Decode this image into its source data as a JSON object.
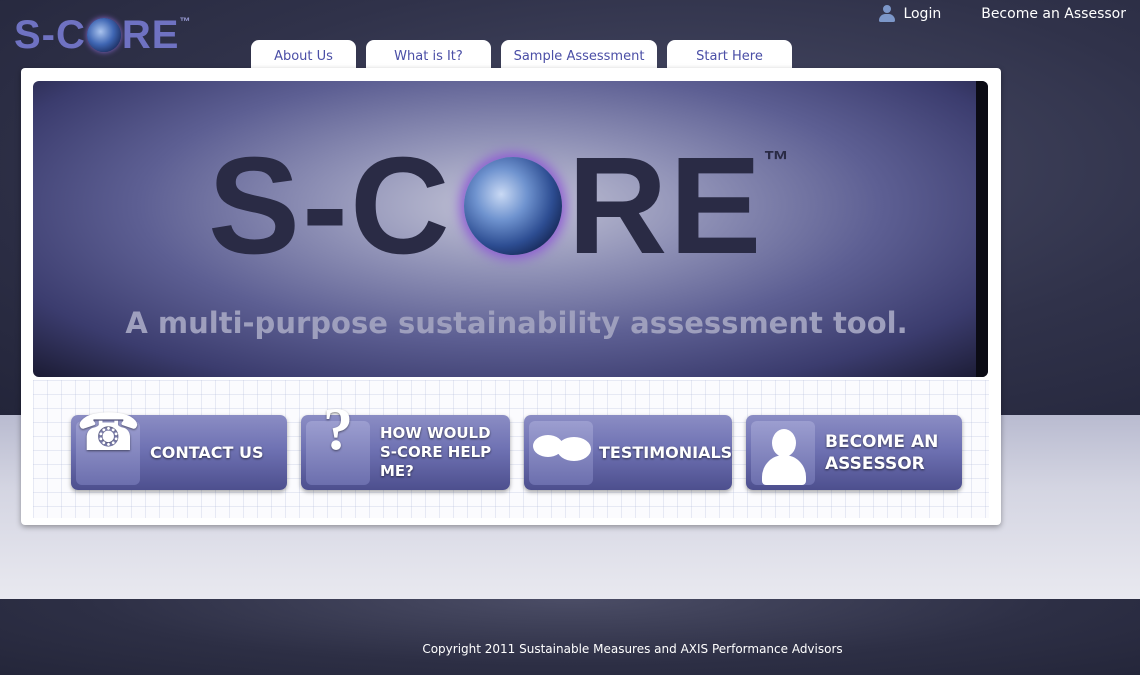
{
  "header": {
    "logo_left": "S-C",
    "logo_right": "RE",
    "logo_tm": "™",
    "top_links": {
      "login": "Login",
      "become_assessor": "Become an Assessor"
    }
  },
  "nav": {
    "tabs": [
      {
        "label": "About Us"
      },
      {
        "label": "What is It?"
      },
      {
        "label": "Sample Assessment"
      },
      {
        "label": "Start Here"
      }
    ]
  },
  "hero": {
    "logo_left": "S-C",
    "logo_right": "RE",
    "logo_tm": "™",
    "tagline": "A multi-purpose sustainability assessment tool."
  },
  "features": [
    {
      "label": "CONTACT US",
      "icon": "phone-icon"
    },
    {
      "label": "HOW WOULD\nS-CORE HELP\nME?",
      "icon": "question-mark-icon"
    },
    {
      "label": "TESTIMONIALS",
      "icon": "speech-bubbles-icon"
    },
    {
      "label": "BECOME AN\nASSESSOR",
      "icon": "person-icon"
    }
  ],
  "footer": {
    "copyright": "Copyright 2011 Sustainable Measures and AXIS Performance Advisors"
  },
  "colors": {
    "accent": "#6f72c2",
    "tab_text": "#4a4ea6",
    "dark_bg": "#30324a"
  }
}
